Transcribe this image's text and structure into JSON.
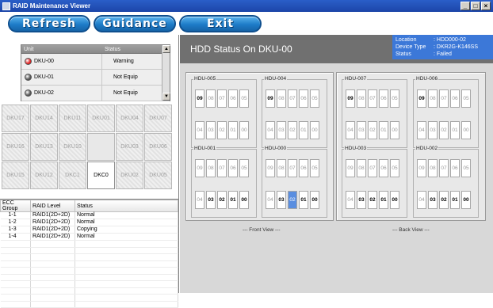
{
  "window": {
    "title": "RAID Maintenance Viewer"
  },
  "toolbar": {
    "refresh": "Refresh",
    "guidance": "Guidance",
    "exit": "Exit"
  },
  "units": {
    "headers": {
      "unit": "Unit",
      "status": "Status"
    },
    "rows": [
      {
        "name": "DKU-00",
        "status": "Warning",
        "led": "#e02020"
      },
      {
        "name": "DKU-01",
        "status": "Not Equip",
        "led": "#555555"
      },
      {
        "name": "DKU-02",
        "status": "Not Equip",
        "led": "#555555"
      }
    ]
  },
  "dku_grid": [
    "DKU17",
    "DKU14",
    "DKU11",
    "DKU01",
    "DKU04",
    "DKU07",
    "DKU16",
    "DKU13",
    "DKU10",
    "",
    "DKU03",
    "DKU06",
    "DKU15",
    "DKU12",
    "DKC1",
    "DKC0",
    "DKU02",
    "DKU05"
  ],
  "ecc": {
    "headers": [
      "ECC Group",
      "RAID Level",
      "Status"
    ],
    "rows": [
      [
        "1-1",
        "RAID1(2D+2D)",
        "Normal"
      ],
      [
        "1-2",
        "RAID1(2D+2D)",
        "Normal"
      ],
      [
        "1-3",
        "RAID1(2D+2D)",
        "Copying"
      ],
      [
        "1-4",
        "RAID1(2D+2D)",
        "Normal"
      ]
    ]
  },
  "hdd": {
    "title": "HDD Status On DKU-00",
    "info": {
      "location_label": "Location",
      "location": ": HDD000-02",
      "device_label": "Device Type",
      "device": ": DKR2G-K146SS",
      "status_label": "Status",
      "status": ": Failed"
    },
    "front_label": "--- Front View ---",
    "back_label": "--- Back View ---",
    "row_top": [
      "09",
      "08",
      "07",
      "06",
      "05"
    ],
    "row_bottom": [
      "04",
      "03",
      "02",
      "01",
      "00"
    ],
    "hdus": [
      {
        "name": "HDU-005",
        "top_on": [
          0
        ],
        "bot_on": [],
        "sel": []
      },
      {
        "name": "HDU-004",
        "top_on": [
          0
        ],
        "bot_on": [],
        "sel": []
      },
      {
        "name": "HDU-001",
        "top_on": [],
        "bot_on": [
          1,
          2,
          3,
          4
        ],
        "sel": []
      },
      {
        "name": "HDU-000",
        "top_on": [],
        "bot_on": [
          1,
          3,
          4
        ],
        "sel": [
          2
        ]
      },
      {
        "name": "HDU-007",
        "top_on": [
          0
        ],
        "bot_on": [],
        "sel": []
      },
      {
        "name": "HDU-006",
        "top_on": [
          0
        ],
        "bot_on": [],
        "sel": []
      },
      {
        "name": "HDU-003",
        "top_on": [],
        "bot_on": [
          1,
          2,
          3,
          4
        ],
        "sel": []
      },
      {
        "name": "HDU-002",
        "top_on": [],
        "bot_on": [
          1,
          2,
          3,
          4
        ],
        "sel": []
      }
    ]
  }
}
